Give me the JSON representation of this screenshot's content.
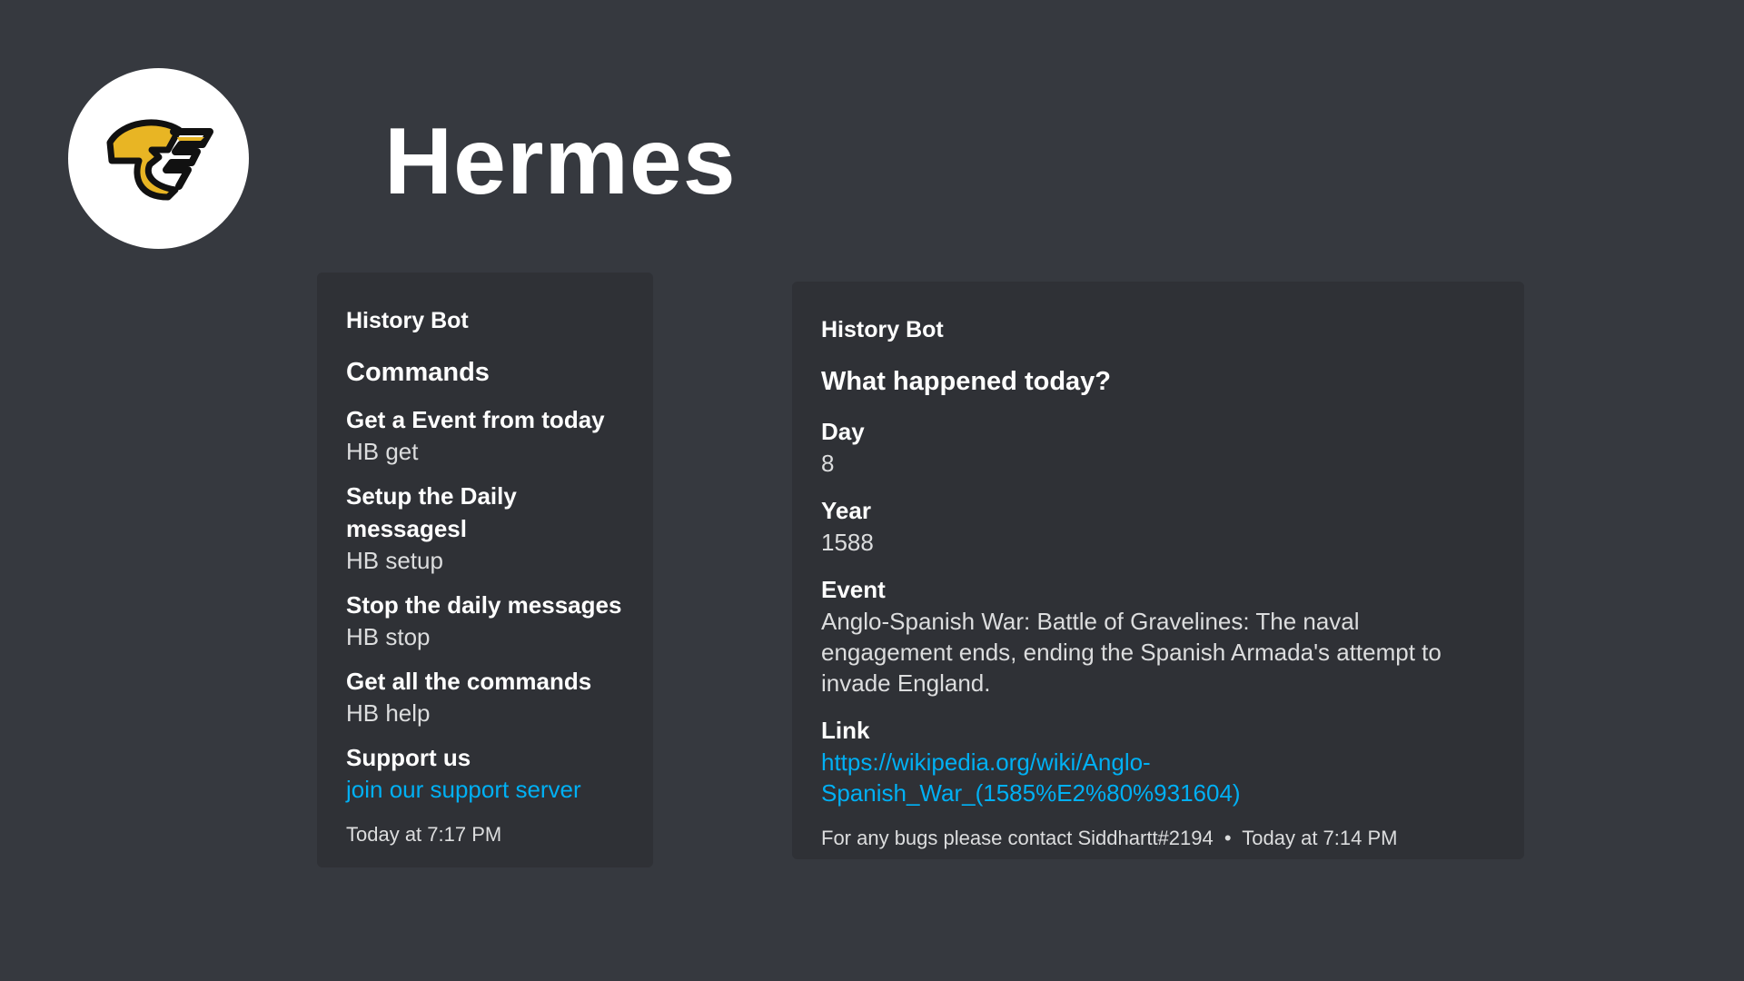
{
  "app": {
    "title": "Hermes",
    "logo_icon": "winged-hermes-logo-icon",
    "colors": {
      "background": "#36393f",
      "embed": "#2f3136",
      "link": "#00b0f4",
      "logo_yellow": "#e8b524"
    }
  },
  "commands_embed": {
    "author": "History Bot",
    "title": "Commands",
    "fields": [
      {
        "name": "Get a Event from today",
        "value": "HB get"
      },
      {
        "name": "Setup the Daily messagesl",
        "value": "HB setup"
      },
      {
        "name": "Stop the daily messages",
        "value": "HB stop"
      },
      {
        "name": "Get all the commands",
        "value": "HB help"
      },
      {
        "name": "Support us",
        "value": "join our support server"
      }
    ],
    "timestamp": "Today at 7:17 PM"
  },
  "event_embed": {
    "author": "History Bot",
    "title": "What happened today?",
    "fields": [
      {
        "name": "Day",
        "value": "8"
      },
      {
        "name": "Year",
        "value": "1588"
      },
      {
        "name": "Event",
        "value": "Anglo-Spanish War: Battle of Gravelines: The naval engagement ends, ending the Spanish Armada's attempt to invade England."
      },
      {
        "name": "Link",
        "value_line1": "https://wikipedia.org/wiki/Anglo-",
        "value_line2": "Spanish_War_(1585%E2%80%931604)"
      }
    ],
    "footer_text": "For any bugs please contact Siddhartt#2194",
    "footer_separator": "•",
    "timestamp": "Today at 7:14 PM"
  }
}
